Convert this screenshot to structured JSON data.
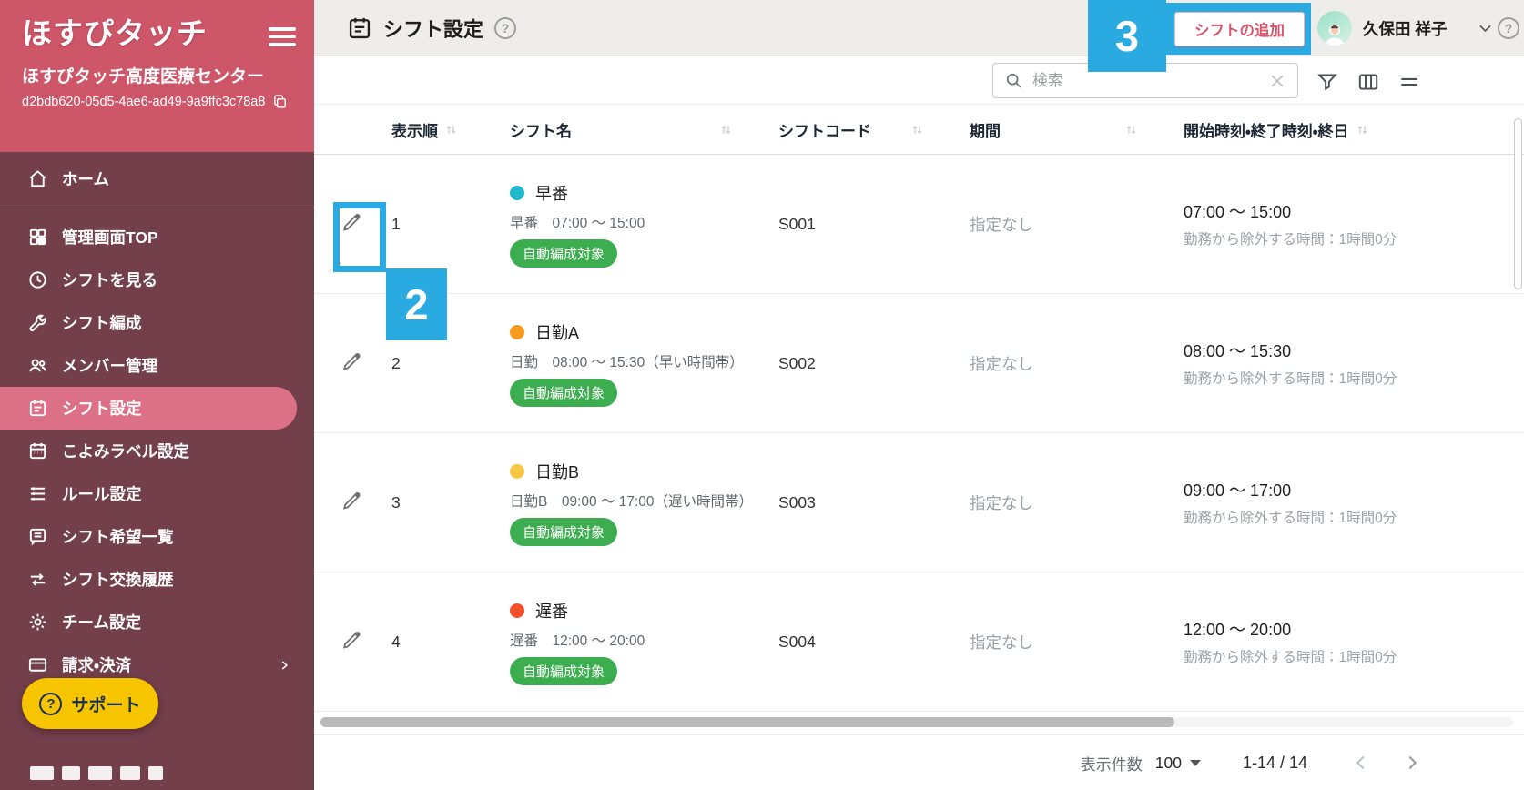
{
  "colors": {
    "sidebar_top": "#ce5669",
    "sidebar_nav": "#723f4b",
    "active_item": "#dc7086",
    "annotation_blue": "#29abe2",
    "badge_green": "#3dae4f",
    "accent_pink": "#d9556b",
    "support_yellow": "#f6c500"
  },
  "app": {
    "logo": "ほすぴタッチ",
    "facility_name": "ほすぴタッチ高度医療センター",
    "facility_id": "d2bdb620-05d5-4ae6-ad49-9a9ffc3c78a8"
  },
  "sidebar": {
    "items": [
      {
        "label": "ホーム"
      },
      {
        "label": "管理画面TOP"
      },
      {
        "label": "シフトを見る"
      },
      {
        "label": "シフト編成"
      },
      {
        "label": "メンバー管理"
      },
      {
        "label": "シフト設定",
        "active": true
      },
      {
        "label": "こよみラベル設定"
      },
      {
        "label": "ルール設定"
      },
      {
        "label": "シフト希望一覧"
      },
      {
        "label": "シフト交換履歴"
      },
      {
        "label": "チーム設定"
      },
      {
        "label": "請求・決済"
      }
    ],
    "support_label": "サポート"
  },
  "header": {
    "title": "シフト設定",
    "add_button": "シフトの追加",
    "user_name": "久保田 祥子"
  },
  "toolbar": {
    "search_placeholder": "検索"
  },
  "table": {
    "columns": [
      "表示順",
      "シフト名",
      "シフトコード",
      "期間",
      "開始時刻・終了時刻・終日"
    ],
    "rows": [
      {
        "order": "1",
        "dot_color": "#22b8ce",
        "name": "早番",
        "detail": "早番　07:00 〜 15:00",
        "badge": "自動編成対象",
        "code": "S001",
        "period": "指定なし",
        "time": "07:00 〜 15:00",
        "time_note": "勤務から除外する時間：1時間0分"
      },
      {
        "order": "2",
        "dot_color": "#f79a1f",
        "name": "日勤A",
        "detail": "日勤　08:00 〜 15:30（早い時間帯）",
        "badge": "自動編成対象",
        "code": "S002",
        "period": "指定なし",
        "time": "08:00 〜 15:30",
        "time_note": "勤務から除外する時間：1時間0分"
      },
      {
        "order": "3",
        "dot_color": "#f6c743",
        "name": "日勤B",
        "detail": "日勤B　09:00 〜 17:00（遅い時間帯）",
        "badge": "自動編成対象",
        "code": "S003",
        "period": "指定なし",
        "time": "09:00 〜 17:00",
        "time_note": "勤務から除外する時間：1時間0分"
      },
      {
        "order": "4",
        "dot_color": "#f2512b",
        "name": "遅番",
        "detail": "遅番　12:00 〜 20:00",
        "badge": "自動編成対象",
        "code": "S004",
        "period": "指定なし",
        "time": "12:00 〜 20:00",
        "time_note": "勤務から除外する時間：1時間0分"
      }
    ]
  },
  "footer": {
    "per_page_label": "表示件数",
    "per_page_value": "100",
    "range": "1-14 / 14"
  },
  "annotations": {
    "step2": "2",
    "step3": "3"
  }
}
